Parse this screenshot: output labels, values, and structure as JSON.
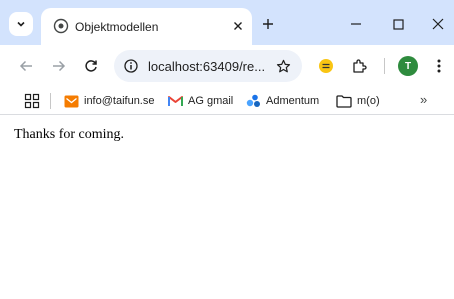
{
  "colors": {
    "tabstrip_bg": "#d3e3fd",
    "omnibox_bg": "#eef2f9",
    "avatar_bg": "#2e8b3e",
    "gmail_red": "#ea4335",
    "mail_orange": "#f57c00"
  },
  "tab": {
    "title": "Objektmodellen",
    "favicon": "globe-icon"
  },
  "toolbar": {
    "url": "localhost:63409/re...",
    "avatar_letter": "T"
  },
  "bookmarks": [
    {
      "label": "info@taifun.se",
      "icon": "mail-icon"
    },
    {
      "label": "AG gmail",
      "icon": "gmail-icon"
    },
    {
      "label": "Admentum",
      "icon": "admentum-icon"
    },
    {
      "label": "m(o)",
      "icon": "folder-icon"
    }
  ],
  "page": {
    "text": "Thanks for coming."
  }
}
